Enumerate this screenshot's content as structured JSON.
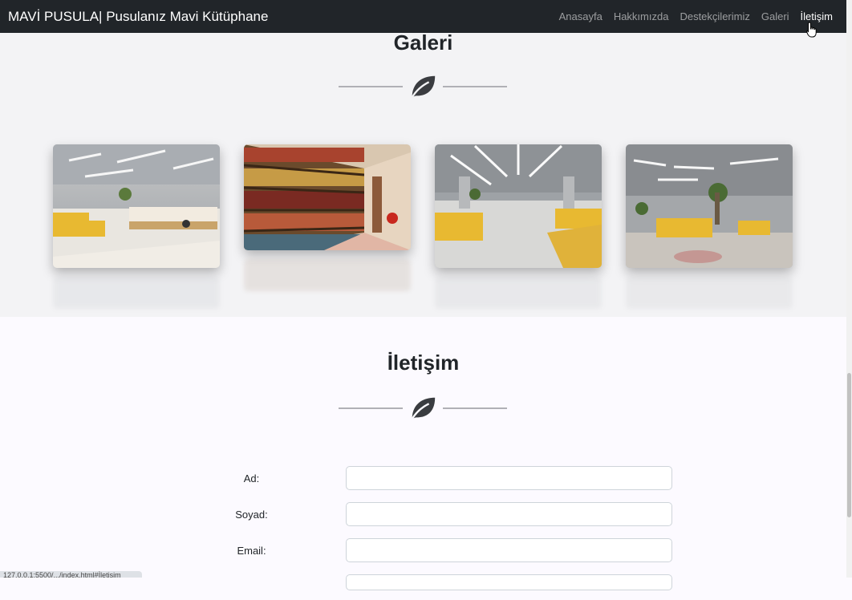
{
  "navbar": {
    "brand": "MAVİ PUSULA| Pusulanız Mavi Kütüphane",
    "links": [
      "Anasayfa",
      "Hakkımızda",
      "Destekçilerimiz",
      "Galeri",
      "İletişim"
    ],
    "active": "İletişim"
  },
  "gallery": {
    "title": "Galeri",
    "icon": "leaf-icon",
    "images": [
      {
        "name": "library-photo-1",
        "description": "open library hall with yellow chairs"
      },
      {
        "name": "library-photo-2",
        "description": "bookshelves with colorful books"
      },
      {
        "name": "library-photo-3",
        "description": "open study area with yellow sofas"
      },
      {
        "name": "library-photo-4",
        "description": "lounge with yellow sofas and plants"
      }
    ]
  },
  "contact": {
    "title": "İletişim",
    "icon": "leaf-icon",
    "fields": [
      {
        "label": "Ad:",
        "value": "",
        "placeholder": ""
      },
      {
        "label": "Soyad:",
        "value": "",
        "placeholder": ""
      },
      {
        "label": "Email:",
        "value": "",
        "placeholder": ""
      }
    ]
  },
  "status_url": "127.0.0.1:5500/.../index.html#İletişim",
  "colors": {
    "navbar_bg": "#212529",
    "accent_yellow": "#e8b931",
    "text_dark": "#212529"
  }
}
